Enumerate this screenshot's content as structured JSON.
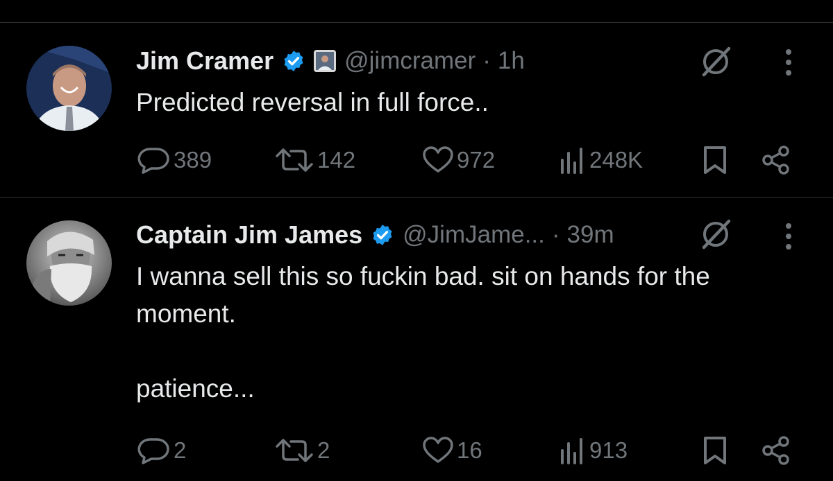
{
  "tweets": [
    {
      "author_name": "Jim Cramer",
      "handle": "@jimcramer",
      "separator": "·",
      "time": "1h",
      "text": "Predicted reversal in full force..",
      "replies": "389",
      "reposts": "142",
      "likes": "972",
      "views": "248K",
      "verified": true,
      "has_affiliate_badge": true
    },
    {
      "author_name": "Captain Jim James",
      "handle": "@JimJame...",
      "separator": "·",
      "time": "39m",
      "text": "I wanna sell this so fuckin bad. sit on hands for the moment.\n\npatience...",
      "replies": "2",
      "reposts": "2",
      "likes": "16",
      "views": "913",
      "verified": true,
      "has_affiliate_badge": false
    }
  ],
  "icons": {
    "reply": "reply-icon",
    "repost": "repost-icon",
    "like": "heart-icon",
    "views": "views-icon",
    "bookmark": "bookmark-icon",
    "share": "share-icon",
    "grok": "grok-icon",
    "more": "more-icon",
    "verified": "verified-badge-icon"
  },
  "colors": {
    "background": "#000000",
    "text_primary": "#e7e9ea",
    "text_secondary": "#71767b",
    "verified_blue": "#1d9bf0",
    "divider": "#2f3336"
  }
}
